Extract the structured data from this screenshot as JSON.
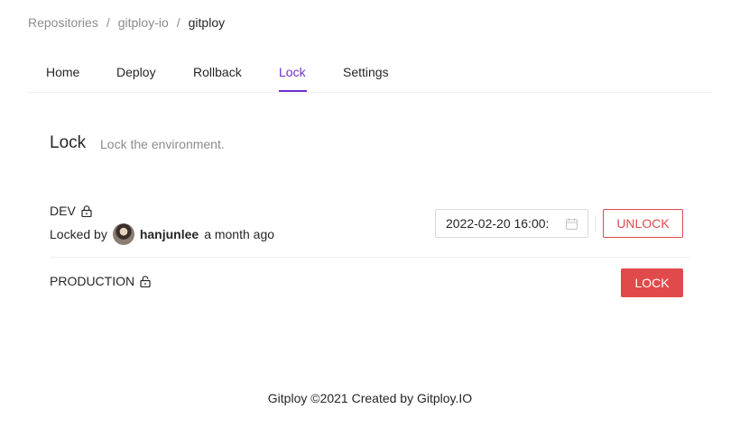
{
  "breadcrumb": {
    "items": [
      "Repositories",
      "gitploy-io",
      "gitploy"
    ],
    "separator": "/"
  },
  "tabs": [
    {
      "label": "Home",
      "active": false
    },
    {
      "label": "Deploy",
      "active": false
    },
    {
      "label": "Rollback",
      "active": false
    },
    {
      "label": "Lock",
      "active": true
    },
    {
      "label": "Settings",
      "active": false
    }
  ],
  "section": {
    "title": "Lock",
    "description": "Lock the environment."
  },
  "environments": [
    {
      "name": "DEV",
      "locked": true,
      "locked_by_prefix": "Locked by",
      "user": "hanjunlee",
      "time_ago": "a month ago",
      "expire_value": "2022-02-20 16:00:",
      "action_label": "UNLOCK"
    },
    {
      "name": "PRODUCTION",
      "locked": false,
      "action_label": "LOCK"
    }
  ],
  "footer": {
    "text": "Gitploy ©2021 Created by Gitploy.IO"
  },
  "colors": {
    "accent": "#722ed1",
    "danger": "#e14a4a"
  }
}
